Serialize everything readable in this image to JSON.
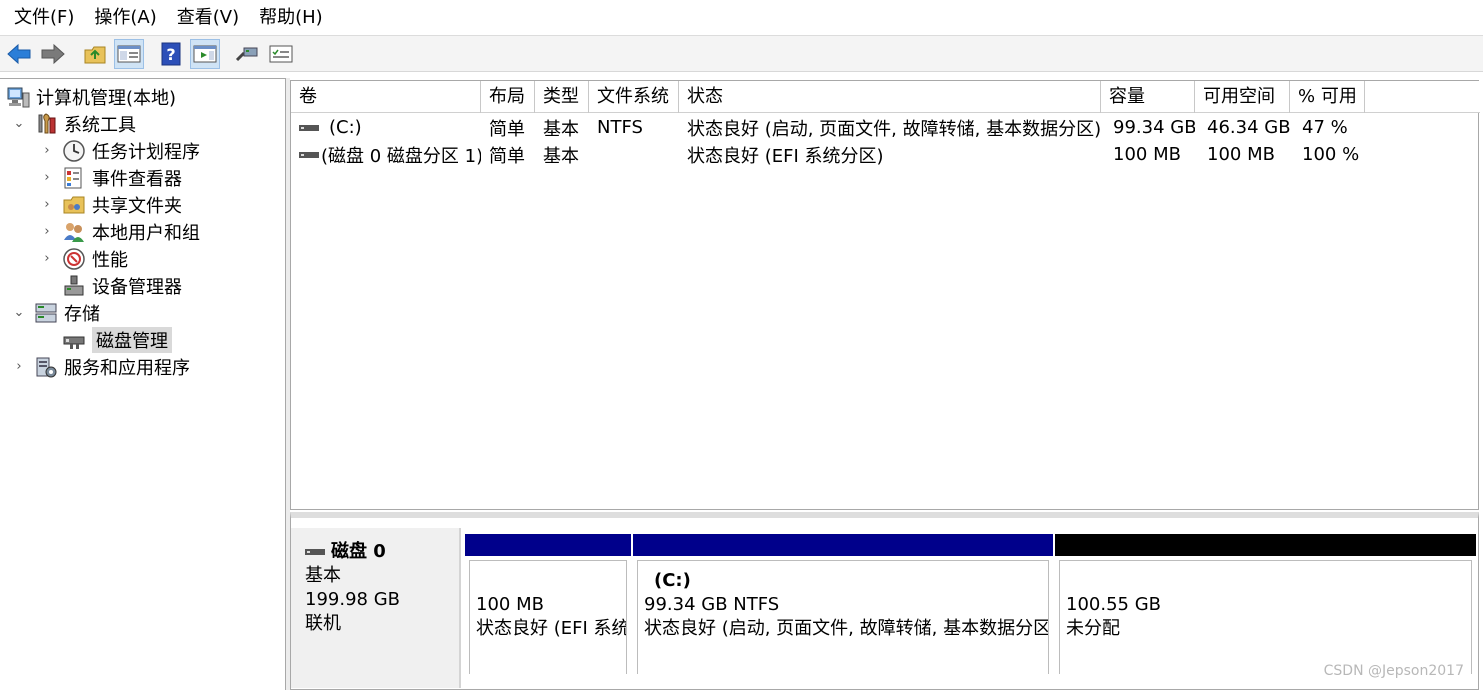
{
  "menu": [
    "文件(F)",
    "操作(A)",
    "查看(V)",
    "帮助(H)"
  ],
  "toolbar": {
    "icons": [
      "back-arrow-icon",
      "forward-arrow-icon",
      "up-folder-icon",
      "console-tree-icon",
      "help-icon",
      "action-pane-icon",
      "disk-connect-icon",
      "properties-icon"
    ]
  },
  "tree": {
    "root": "计算机管理(本地)",
    "system_tools": "系统工具",
    "task_scheduler": "任务计划程序",
    "event_viewer": "事件查看器",
    "shared_folders": "共享文件夹",
    "local_users": "本地用户和组",
    "performance": "性能",
    "device_manager": "设备管理器",
    "storage": "存储",
    "disk_management": "磁盘管理",
    "services_apps": "服务和应用程序"
  },
  "volumes": {
    "columns": [
      "卷",
      "布局",
      "类型",
      "文件系统",
      "状态",
      "容量",
      "可用空间",
      "% 可用"
    ],
    "rows": [
      {
        "volume": "(C:)",
        "layout": "简单",
        "type": "基本",
        "fs": "NTFS",
        "status": "状态良好 (启动, 页面文件, 故障转储, 基本数据分区)",
        "capacity": "99.34 GB",
        "free": "46.34 GB",
        "pct": "47 %"
      },
      {
        "volume": "(磁盘 0 磁盘分区 1)",
        "layout": "简单",
        "type": "基本",
        "fs": "",
        "status": "状态良好 (EFI 系统分区)",
        "capacity": "100 MB",
        "free": "100 MB",
        "pct": "100 %"
      }
    ]
  },
  "disk": {
    "name": "磁盘 0",
    "type": "基本",
    "size": "199.98 GB",
    "state": "联机",
    "partitions": [
      {
        "name": "",
        "size": "100 MB",
        "status": "状态良好 (EFI 系统",
        "color": "#00008b"
      },
      {
        "name": "(C:)",
        "size": "99.34 GB NTFS",
        "status": "状态良好 (启动, 页面文件, 故障转储, 基本数据分区",
        "color": "#00008b"
      },
      {
        "name": "",
        "size": "100.55 GB",
        "status": "未分配",
        "color": "#000000"
      }
    ]
  },
  "watermark": "CSDN @Jepson2017"
}
